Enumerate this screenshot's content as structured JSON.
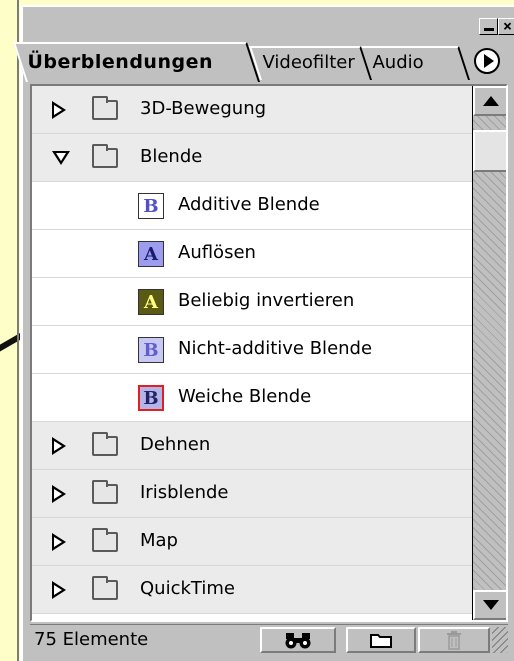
{
  "window": {
    "minimize_label": "—",
    "close_label": "×"
  },
  "tabs": [
    {
      "label": "Überblendungen",
      "active": true
    },
    {
      "label": "Videofilter",
      "active": false
    },
    {
      "label": "Audio",
      "active": false
    }
  ],
  "tree": [
    {
      "type": "folder",
      "label": "3D-Bewegung",
      "expanded": false
    },
    {
      "type": "folder",
      "label": "Blende",
      "expanded": true
    },
    {
      "type": "item",
      "label": "Additive Blende",
      "icon_glyph": "B",
      "icon_bg": "#ffffff",
      "icon_color": "#5050c8",
      "icon_border": "#333333"
    },
    {
      "type": "item",
      "label": "Auflösen",
      "icon_glyph": "A",
      "icon_bg": "#9d9df0",
      "icon_color": "#1a1a6e",
      "icon_border": "#333333"
    },
    {
      "type": "item",
      "label": "Beliebig invertieren",
      "icon_glyph": "A",
      "icon_bg": "#5a5a14",
      "icon_color": "#ffff80",
      "icon_border": "#333333"
    },
    {
      "type": "item",
      "label": "Nicht-additive Blende",
      "icon_glyph": "B",
      "icon_bg": "#c8c8f5",
      "icon_color": "#6060c8",
      "icon_border": "#333333"
    },
    {
      "type": "item",
      "label": "Weiche Blende",
      "icon_glyph": "B",
      "icon_bg": "#b4b4e8",
      "icon_color": "#222266",
      "icon_border": "#e02020"
    },
    {
      "type": "folder",
      "label": "Dehnen",
      "expanded": false
    },
    {
      "type": "folder",
      "label": "Irisblende",
      "expanded": false
    },
    {
      "type": "folder",
      "label": "Map",
      "expanded": false
    },
    {
      "type": "folder",
      "label": "QuickTime",
      "expanded": false
    }
  ],
  "status": {
    "count_text": "75 Elemente",
    "find_icon": "binoculars-icon",
    "new_folder_icon": "folder-icon",
    "delete_icon": "trash-icon"
  }
}
